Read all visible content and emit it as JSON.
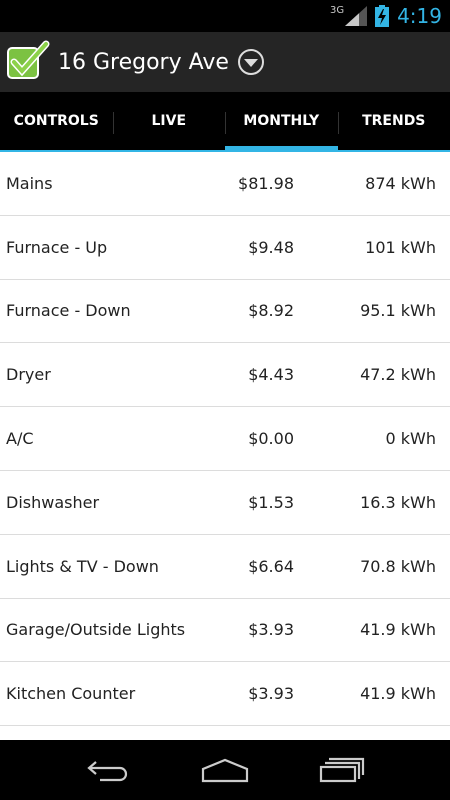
{
  "status": {
    "network": "3G",
    "time": "4:19"
  },
  "header": {
    "title": "16 Gregory Ave",
    "icon": "checkmark-app-icon",
    "menu_icon": "dropdown-icon"
  },
  "tabs": [
    {
      "label": "CONTROLS",
      "active": false
    },
    {
      "label": "LIVE",
      "active": false
    },
    {
      "label": "MONTHLY",
      "active": true
    },
    {
      "label": "TRENDS",
      "active": false
    }
  ],
  "rows": [
    {
      "name": "Mains",
      "cost": "$81.98",
      "energy": "874 kWh"
    },
    {
      "name": "Furnace - Up",
      "cost": "$9.48",
      "energy": "101 kWh"
    },
    {
      "name": "Furnace - Down",
      "cost": "$8.92",
      "energy": "95.1 kWh"
    },
    {
      "name": "Dryer",
      "cost": "$4.43",
      "energy": "47.2 kWh"
    },
    {
      "name": "A/C",
      "cost": "$0.00",
      "energy": "0 kWh"
    },
    {
      "name": "Dishwasher",
      "cost": "$1.53",
      "energy": "16.3 kWh"
    },
    {
      "name": "Lights & TV - Down",
      "cost": "$6.64",
      "energy": "70.8 kWh"
    },
    {
      "name": "Garage/Outside Lights",
      "cost": "$3.93",
      "energy": "41.9 kWh"
    },
    {
      "name": "Kitchen Counter",
      "cost": "$3.93",
      "energy": "41.9 kWh"
    }
  ],
  "colors": {
    "accent": "#33b5e5",
    "action_bar": "#252525",
    "list_bg": "#ffffff"
  }
}
